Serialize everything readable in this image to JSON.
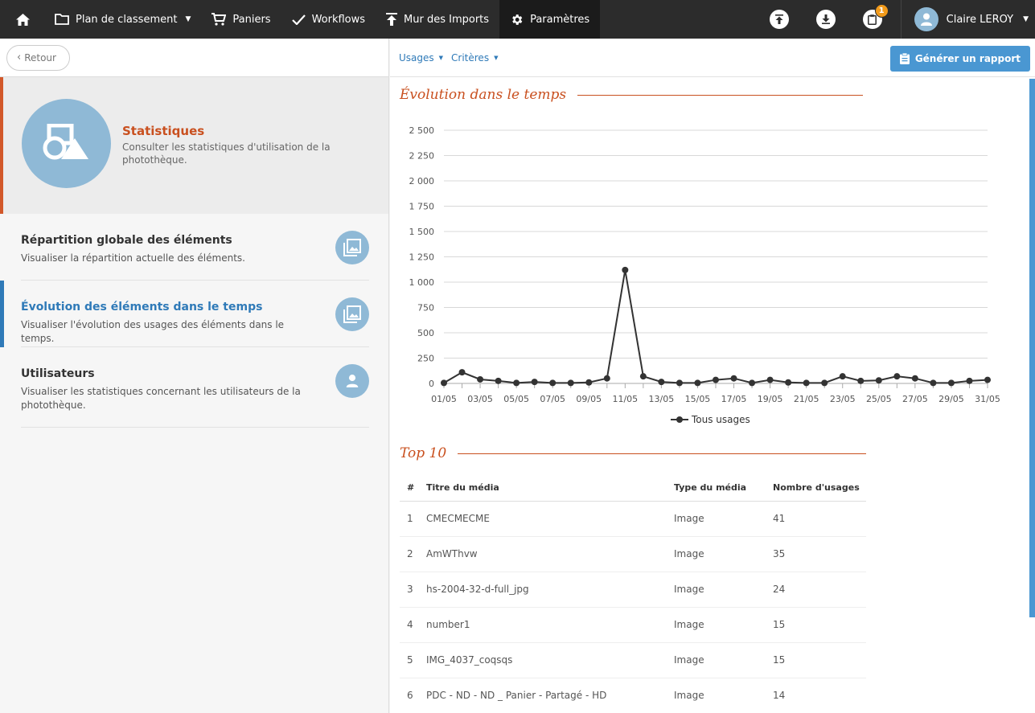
{
  "topbar": {
    "nav": [
      {
        "label": "Plan de classement",
        "has_caret": true
      },
      {
        "label": "Paniers"
      },
      {
        "label": "Workflows"
      },
      {
        "label": "Mur des Imports"
      },
      {
        "label": "Paramètres",
        "active": true
      }
    ],
    "clipboard_badge": "1",
    "user_name": "Claire LEROY"
  },
  "left": {
    "back_label": "Retour",
    "hero": {
      "title": "Statistiques",
      "description": "Consulter les statistiques d'utilisation de la photothèque."
    },
    "menu": [
      {
        "title": "Répartition globale des éléments",
        "description": "Visualiser la répartition actuelle des éléments."
      },
      {
        "title": "Évolution des éléments dans le temps",
        "description": "Visualiser l'évolution des usages des éléments dans le temps.",
        "active": true
      },
      {
        "title": "Utilisateurs",
        "description": "Visualiser les statistiques concernant les utilisateurs de la photothèque."
      }
    ]
  },
  "right": {
    "filters": {
      "usages": "Usages",
      "criteres": "Critères"
    },
    "report_button": "Générer un rapport",
    "evolution_title": "Évolution dans le temps",
    "top10_title": "Top 10",
    "top10": {
      "headers": {
        "num": "#",
        "title": "Titre du média",
        "type": "Type du média",
        "count": "Nombre d'usages"
      },
      "rows": [
        {
          "num": "1",
          "title": "CMECMECME",
          "type": "Image",
          "count": "41"
        },
        {
          "num": "2",
          "title": "AmWThvw",
          "type": "Image",
          "count": "35"
        },
        {
          "num": "3",
          "title": "hs-2004-32-d-full_jpg",
          "type": "Image",
          "count": "24"
        },
        {
          "num": "4",
          "title": "number1",
          "type": "Image",
          "count": "15"
        },
        {
          "num": "5",
          "title": "IMG_4037_coqsqs",
          "type": "Image",
          "count": "15"
        },
        {
          "num": "6",
          "title": "PDC - ND - ND _ Panier - Partagé - HD",
          "type": "Image",
          "count": "14"
        }
      ]
    }
  },
  "chart_data": {
    "type": "line",
    "ylim": [
      0,
      2500
    ],
    "yticks": [
      0,
      250,
      500,
      750,
      1000,
      1250,
      1500,
      1750,
      2000,
      2250,
      2500
    ],
    "ytick_labels": [
      "0",
      "250",
      "500",
      "750",
      "1 000",
      "1 250",
      "1 500",
      "1 750",
      "2 000",
      "2 250",
      "2 500"
    ],
    "x_tick_labels": [
      "01/05",
      "03/05",
      "05/05",
      "07/05",
      "09/05",
      "11/05",
      "13/05",
      "15/05",
      "17/05",
      "19/05",
      "21/05",
      "23/05",
      "25/05",
      "27/05",
      "29/05",
      "31/05"
    ],
    "x": [
      "01/05",
      "02/05",
      "03/05",
      "04/05",
      "05/05",
      "06/05",
      "07/05",
      "08/05",
      "09/05",
      "10/05",
      "11/05",
      "12/05",
      "13/05",
      "14/05",
      "15/05",
      "16/05",
      "17/05",
      "18/05",
      "19/05",
      "20/05",
      "21/05",
      "22/05",
      "23/05",
      "24/05",
      "25/05",
      "26/05",
      "27/05",
      "28/05",
      "29/05",
      "30/05",
      "31/05"
    ],
    "series": [
      {
        "name": "Tous usages",
        "values": [
          5,
          110,
          40,
          25,
          5,
          15,
          5,
          5,
          10,
          50,
          1120,
          70,
          15,
          5,
          5,
          35,
          50,
          5,
          35,
          10,
          5,
          5,
          70,
          25,
          30,
          70,
          50,
          5,
          5,
          25,
          35
        ],
        "color": "#333333"
      }
    ],
    "legend": "bottom-center",
    "grid": true
  },
  "colors": {
    "accent": "#c9501f",
    "primary": "#2f7ab8",
    "icon_bg": "#8fb9d6",
    "button": "#4a97d2",
    "badge": "#f29b1b"
  }
}
